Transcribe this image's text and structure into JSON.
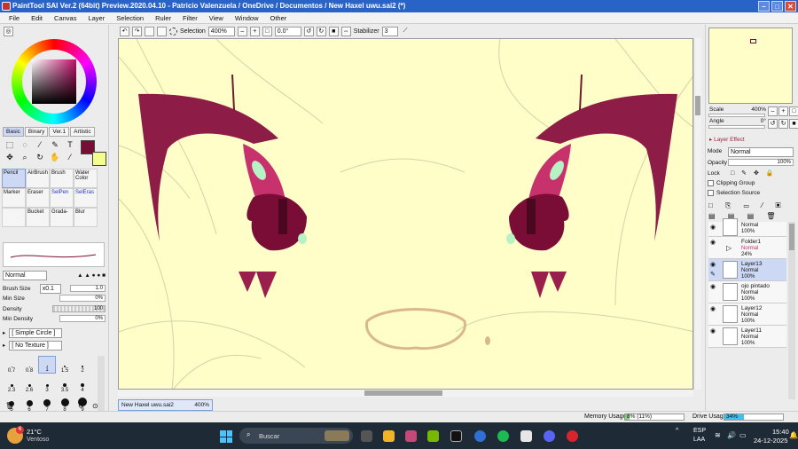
{
  "window": {
    "title": "PaintTool SAI Ver.2 (64bit) Preview.2020.04.10 - Patricio Valenzuela / OneDrive / Documentos / New Haxel uwu.sai2 (*)",
    "minimize": "–",
    "maximize": "□",
    "close": "✕"
  },
  "menu": [
    "File",
    "Edit",
    "Canvas",
    "Layer",
    "Selection",
    "Ruler",
    "Filter",
    "View",
    "Window",
    "Other"
  ],
  "toolbar": {
    "selection_label": "Selection",
    "zoom": "400%",
    "angle": "0.0°",
    "stabilizer_label": "Stabilizer",
    "stabilizer_value": "3"
  },
  "colors": {
    "primary": "#7a0d35",
    "secondary": "#f3ff8a",
    "canvas_bg": "#fffdc8",
    "accent": "#2a63c7"
  },
  "left": {
    "tabs": [
      "Basic",
      "Binary",
      "Ver.1",
      "Artistic"
    ],
    "tool_icons": [
      "rect-select",
      "lasso-select",
      "magic-wand",
      "eyedropper",
      "text",
      "move",
      "zoom",
      "rotate",
      "hand",
      "eyedropper2"
    ],
    "brushes": [
      {
        "label": "Pencil",
        "active": true,
        "blue": false
      },
      {
        "label": "AirBrush",
        "active": false,
        "blue": false
      },
      {
        "label": "Brush",
        "active": false,
        "blue": false
      },
      {
        "label": "Water Color",
        "active": false,
        "blue": false
      },
      {
        "label": "Marker",
        "active": false,
        "blue": false
      },
      {
        "label": "Eraser",
        "active": false,
        "blue": false
      },
      {
        "label": "SelPen",
        "active": false,
        "blue": true
      },
      {
        "label": "SelEras",
        "active": false,
        "blue": true
      },
      {
        "label": "",
        "active": false,
        "blue": false
      },
      {
        "label": "Bucket",
        "active": false,
        "blue": false
      },
      {
        "label": "Grada-",
        "active": false,
        "blue": false
      },
      {
        "label": "Blur",
        "active": false,
        "blue": false
      }
    ],
    "blend_mode": "Normal",
    "brush_size_label": "Brush Size",
    "brush_size_mult": "x0.1",
    "brush_size_value": "1.0",
    "min_size_label": "Min Size",
    "min_size_value": "0%",
    "density_label": "Density",
    "density_value": "100",
    "min_density_label": "Min Density",
    "min_density_value": "0%",
    "shape": "[ Simple Circle ]",
    "texture": "[ No Texture ]",
    "sizes": [
      "0.7",
      "0.8",
      "1",
      "1.5",
      "2",
      "2.3",
      "2.6",
      "3",
      "3.5",
      "4",
      "5",
      "6",
      "7",
      "8",
      "9"
    ],
    "selected_size": "1"
  },
  "doc_tab": {
    "name": "New Haxel uwu.sai2",
    "zoom": "400%"
  },
  "right": {
    "scale_label": "Scale",
    "scale_value": "400%",
    "angle_label": "Angle",
    "angle_value": "0°",
    "layer_effect": "Layer Effect",
    "mode_label": "Mode",
    "mode_value": "Normal",
    "opacity_label": "Opacity",
    "opacity_value": "100%",
    "lock_label": "Lock",
    "clipping_group": "Clipping Group",
    "selection_source": "Selection Source",
    "layers": [
      {
        "name": "",
        "mode": "Normal",
        "opacity": "100%",
        "selected": false,
        "folder": false
      },
      {
        "name": "Folder1",
        "mode": "Normal",
        "opacity": "24%",
        "selected": false,
        "folder": true
      },
      {
        "name": "Layer13",
        "mode": "Normal",
        "opacity": "100%",
        "selected": true,
        "folder": false
      },
      {
        "name": "ojo pintado",
        "mode": "Normal",
        "opacity": "100%",
        "selected": false,
        "folder": false
      },
      {
        "name": "Layer12",
        "mode": "Normal",
        "opacity": "100%",
        "selected": false,
        "folder": false
      },
      {
        "name": "Layer11",
        "mode": "Normal",
        "opacity": "100%",
        "selected": false,
        "folder": false
      }
    ]
  },
  "status": {
    "memory_label": "Memory Usage",
    "memory_value": "8% (11%)",
    "memory_pct": 0.08,
    "drive_label": "Drive Usage",
    "drive_value": "34%",
    "drive_pct": 0.34
  },
  "taskbar": {
    "weather_temp": "21°C",
    "weather_desc": "Ventoso",
    "search_placeholder": "Buscar",
    "lang_top": "ESP",
    "lang_bottom": "LAA",
    "time": "15:40",
    "date": "24-12-2025",
    "notif_count": "6"
  }
}
